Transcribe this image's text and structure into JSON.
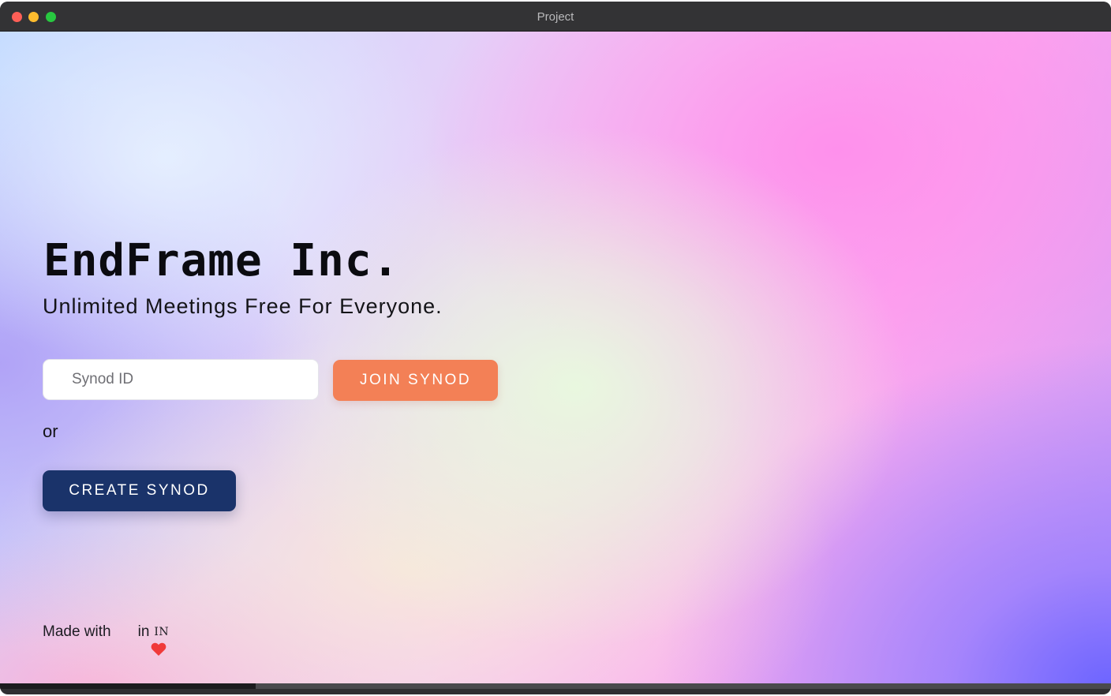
{
  "window": {
    "title": "Project"
  },
  "hero": {
    "brand": "EndFrame Inc.",
    "tagline": "Unlimited Meetings Free For Everyone."
  },
  "join": {
    "input_placeholder": "Synod ID",
    "input_value": "",
    "button_label": "JOIN SYNOD"
  },
  "separator": {
    "text": "or"
  },
  "create": {
    "button_label": "CREATE SYNOD"
  },
  "footer": {
    "made_with": "Made with",
    "icon": "heart-icon",
    "in_text": "in",
    "country": "IN"
  },
  "colors": {
    "join_button": "#f38056",
    "create_button": "#1a336a",
    "heart": "#f03a3a"
  }
}
